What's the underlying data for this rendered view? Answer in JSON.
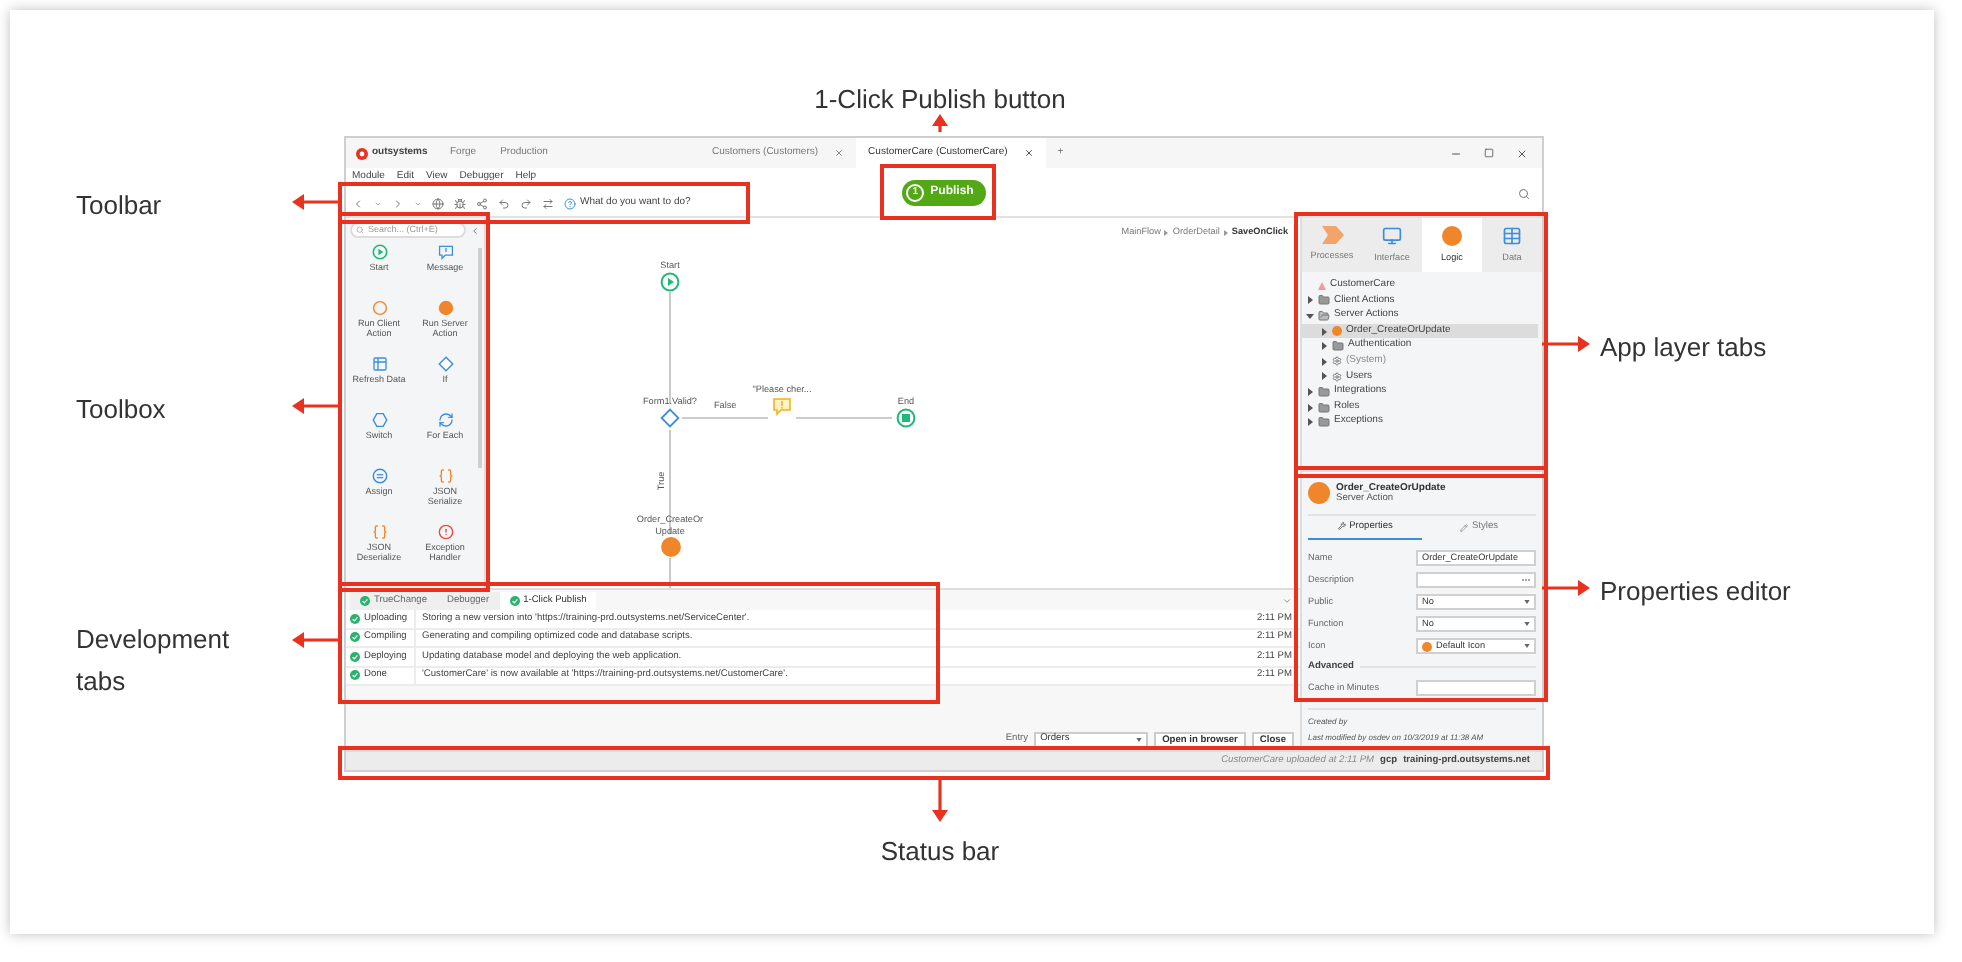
{
  "annotations": [
    {
      "kind": "publish",
      "label": "1-Click Publish button"
    },
    {
      "kind": "toolbar",
      "label": "Toolbar"
    },
    {
      "kind": "toolbox",
      "label": "Toolbox"
    },
    {
      "kind": "dev_tabs",
      "label": "Development tabs"
    },
    {
      "kind": "app_tabs",
      "label": "App layer tabs"
    },
    {
      "kind": "properties",
      "label": "Properties editor"
    },
    {
      "kind": "status",
      "label": "Status bar"
    }
  ],
  "window": {
    "logo": "outsystems",
    "nav": [
      "Forge",
      "Production"
    ],
    "tabs": [
      {
        "label": "Customers (Customers)",
        "selected": false
      },
      {
        "label": "CustomerCare (CustomerCare)",
        "selected": true
      }
    ],
    "new_tab": "+"
  },
  "menu": [
    "Module",
    "Edit",
    "View",
    "Debugger",
    "Help"
  ],
  "publish_button": {
    "step": "1",
    "label": "Publish"
  },
  "toolbar": {
    "help": "What do you want to do?"
  },
  "toolbox": {
    "search_placeholder": "Search... (Ctrl+E)",
    "items": [
      {
        "kind": "start",
        "label": "Start"
      },
      {
        "kind": "message",
        "label": "Message"
      },
      {
        "kind": "client",
        "label": "Run Client Action"
      },
      {
        "kind": "server",
        "label": "Run Server Action"
      },
      {
        "kind": "refresh",
        "label": "Refresh Data"
      },
      {
        "kind": "if",
        "label": "If"
      },
      {
        "kind": "switch",
        "label": "Switch"
      },
      {
        "kind": "foreach",
        "label": "For Each"
      },
      {
        "kind": "assign",
        "label": "Assign"
      },
      {
        "kind": "json_ser",
        "label": "JSON Serialize"
      },
      {
        "kind": "json_deser",
        "label": "JSON Deserialize"
      },
      {
        "kind": "exception",
        "label": "Exception Handler"
      }
    ]
  },
  "canvas": {
    "breadcrumb": [
      "MainFlow",
      "OrderDetail",
      "SaveOnClick"
    ],
    "nodes": [
      {
        "kind": "start",
        "label": "Start"
      },
      {
        "kind": "if",
        "label": "Form1.Valid?"
      },
      {
        "kind": "message",
        "label": "\"Please cher..."
      },
      {
        "kind": "end",
        "label": "End"
      },
      {
        "kind": "server",
        "label": "Order_CreateOr Update"
      }
    ],
    "edge_labels": [
      "False",
      "True"
    ]
  },
  "app_tabs": [
    {
      "kind": "processes",
      "label": "Processes",
      "selected": false
    },
    {
      "kind": "interface",
      "label": "Interface",
      "selected": false
    },
    {
      "kind": "logic",
      "label": "Logic",
      "selected": true
    },
    {
      "kind": "data",
      "label": "Data",
      "selected": false
    }
  ],
  "tree": {
    "kind": "module",
    "label": "CustomerCare",
    "selected": false,
    "children": [
      {
        "kind": "folder",
        "label": "Client Actions",
        "expanded": false,
        "selected": false
      },
      {
        "kind": "folder",
        "label": "Server Actions",
        "expanded": true,
        "selected": false,
        "children": [
          {
            "kind": "action",
            "label": "Order_CreateOrUpdate",
            "expanded": false,
            "selected": true
          },
          {
            "kind": "folder",
            "label": "Authentication",
            "expanded": false,
            "selected": false
          },
          {
            "kind": "reference",
            "label": "(System)",
            "expanded": false,
            "selected": false
          },
          {
            "kind": "reference",
            "label": "Users",
            "expanded": false,
            "selected": false
          }
        ]
      },
      {
        "kind": "folder",
        "label": "Integrations",
        "expanded": false,
        "selected": false
      },
      {
        "kind": "folder",
        "label": "Roles",
        "expanded": false,
        "selected": false
      },
      {
        "kind": "folder",
        "label": "Exceptions",
        "expanded": false,
        "selected": false
      }
    ]
  },
  "properties": {
    "title": "Order_CreateOrUpdate",
    "subtitle": "Server Action",
    "tabs": [
      {
        "kind": "properties",
        "label": "Properties",
        "selected": true
      },
      {
        "kind": "styles",
        "label": "Styles",
        "selected": false
      }
    ],
    "fields": [
      {
        "kind": "text",
        "label": "Name",
        "value": "Order_CreateOrUpdate"
      },
      {
        "kind": "ellipsis",
        "label": "Description"
      },
      {
        "kind": "select",
        "label": "Public",
        "value": "No"
      },
      {
        "kind": "select",
        "label": "Function",
        "value": "No"
      },
      {
        "kind": "icon_select",
        "label": "Icon",
        "value": "Default Icon"
      }
    ],
    "section": "Advanced",
    "advanced_fields": [
      {
        "kind": "text",
        "label": "Cache in Minutes"
      }
    ],
    "created_by": "Created by",
    "last_modified": "Last modified by osdev on 10/3/2019 at 11:38 AM"
  },
  "bottom_tabs": [
    {
      "kind": "check",
      "label": "TrueChange",
      "selected": false
    },
    {
      "kind": "plain",
      "label": "Debugger",
      "selected": false
    },
    {
      "kind": "check",
      "label": "1-Click Publish",
      "selected": true
    }
  ],
  "log": [
    {
      "step": "Uploading",
      "message": "Storing a new version into 'https://training-prd.outsystems.net/ServiceCenter'.",
      "time": "2:11 PM"
    },
    {
      "step": "Compiling",
      "message": "Generating and compiling optimized code and database scripts.",
      "time": "2:11 PM"
    },
    {
      "step": "Deploying",
      "message": "Updating database model and deploying the web application.",
      "time": "2:11 PM"
    },
    {
      "step": "Done",
      "message": "'CustomerCare' is now available at 'https://training-prd.outsystems.net/CustomerCare'.",
      "time": "2:11 PM"
    }
  ],
  "entry": {
    "label": "Entry",
    "value": "Orders",
    "buttons": [
      "Open in browser",
      "Close"
    ]
  },
  "status_bar": {
    "message": "CustomerCare uploaded at 2:11 PM",
    "server_label": "gcp",
    "server": "training-prd.outsystems.net"
  }
}
